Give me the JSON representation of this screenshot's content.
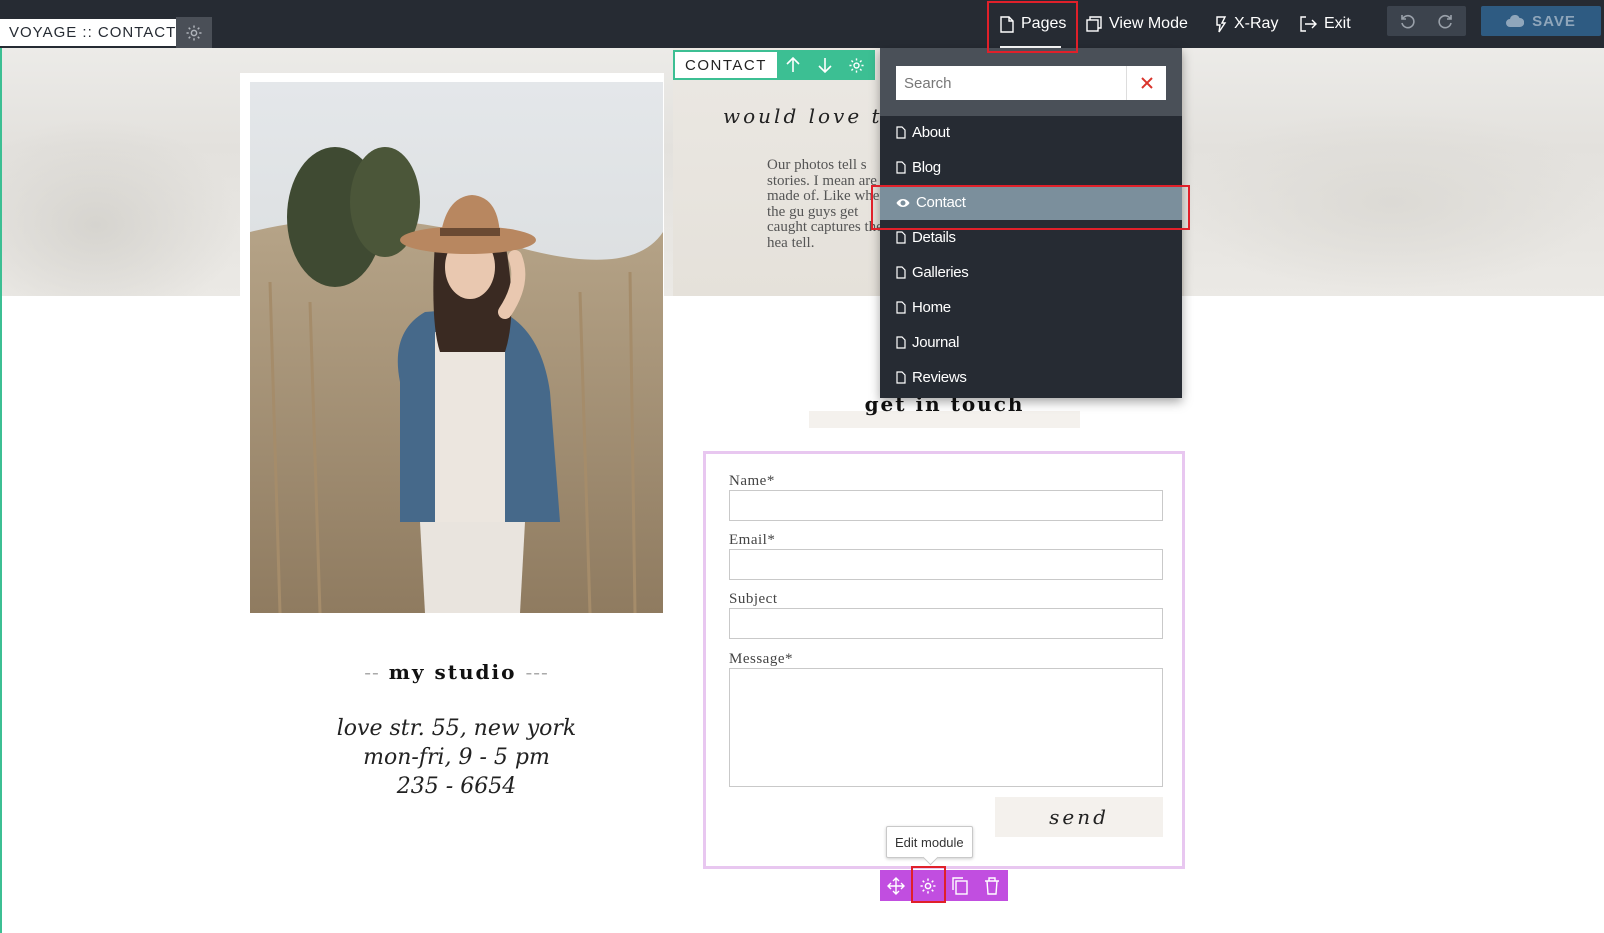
{
  "editor": {
    "site_label": "VOYAGE :: CONTACT",
    "nav": {
      "pages": "Pages",
      "view_mode": "View Mode",
      "xray": "X-Ray",
      "exit": "Exit"
    },
    "save_label": "SAVE"
  },
  "section_tag": {
    "label": "CONTACT"
  },
  "pages_menu": {
    "search_placeholder": "Search",
    "items": [
      {
        "label": "About",
        "icon": "page-icon"
      },
      {
        "label": "Blog",
        "icon": "page-icon"
      },
      {
        "label": "Contact",
        "icon": "eye-icon",
        "active": true
      },
      {
        "label": "Details",
        "icon": "page-icon"
      },
      {
        "label": "Galleries",
        "icon": "page-icon"
      },
      {
        "label": "Home",
        "icon": "page-icon"
      },
      {
        "label": "Journal",
        "icon": "page-icon"
      },
      {
        "label": "Reviews",
        "icon": "page-icon"
      }
    ]
  },
  "hero": {
    "script": "would love to h",
    "paragraph": "Our photos tell s stories. I mean are made of. Like when the gu guys get caught captures the hea tell."
  },
  "studio": {
    "dash_left": "--",
    "title": "my studio",
    "dash_right": "---",
    "lines": [
      "love str. 55, new york",
      "mon-fri, 9 - 5 pm",
      "235 - 6654"
    ]
  },
  "contact_form": {
    "title": "get in touch",
    "fields": {
      "name": "Name*",
      "email": "Email*",
      "subject": "Subject",
      "message": "Message*"
    },
    "send_label": "send"
  },
  "module_toolbar": {
    "tooltip": "Edit module"
  },
  "colors": {
    "editor_bar": "#262b33",
    "section_accent": "#3cbf93",
    "module_accent": "#c14ee0",
    "save_button": "#2e5b82",
    "highlight": "#e0202a"
  }
}
